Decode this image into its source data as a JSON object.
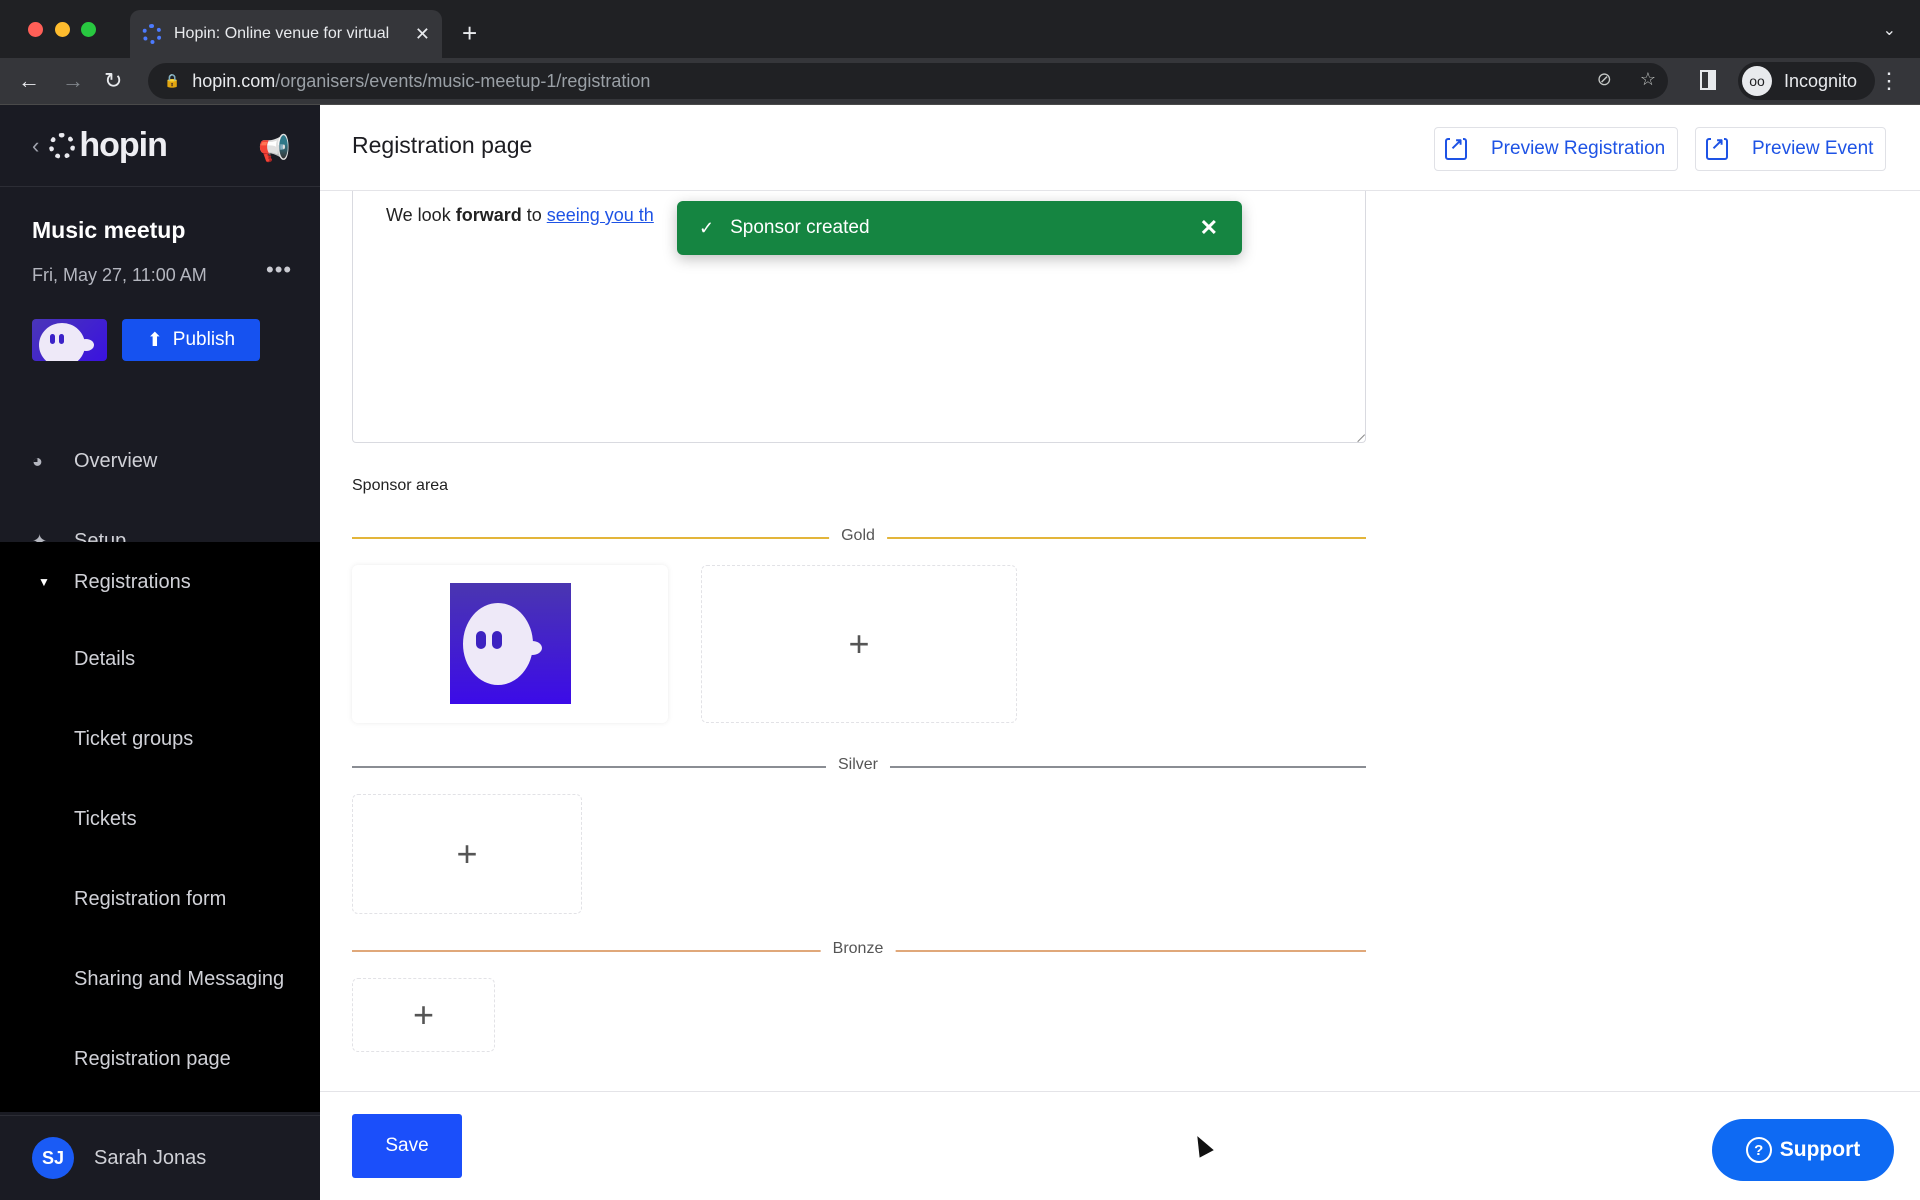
{
  "browser": {
    "tab_title": "Hopin: Online venue for virtual",
    "url_host": "hopin.com",
    "url_path": "/organisers/events/music-meetup-1/registration",
    "profile_label": "Incognito",
    "traffic_colors": [
      "#ff5f57",
      "#febc2e",
      "#28c840"
    ]
  },
  "sidebar": {
    "brand": "hopin",
    "event_name": "Music meetup",
    "event_date": "Fri, May 27, 11:00 AM",
    "publish_label": "Publish",
    "nav": [
      {
        "label": "Overview",
        "icon": "pie-chart-icon"
      },
      {
        "label": "Setup",
        "icon": "magic-wand-icon"
      },
      {
        "label": "Registrations",
        "icon": "caret-down-icon"
      }
    ],
    "sub_items": [
      "Details",
      "Ticket groups",
      "Tickets",
      "Registration form",
      "Sharing and Messaging",
      "Registration page"
    ],
    "user": {
      "initials": "SJ",
      "name": "Sarah Jonas"
    }
  },
  "header": {
    "title": "Registration page",
    "preview_registration": "Preview Registration",
    "preview_event": "Preview Event"
  },
  "editor": {
    "text_pre": "We look ",
    "text_bold": "forward",
    "text_mid": " to ",
    "text_link": "seeing you th"
  },
  "toast": {
    "message": "Sponsor created",
    "color": "#158541"
  },
  "sponsors": {
    "label": "Sponsor area",
    "tiers": [
      {
        "name": "Gold",
        "color": "#e3b53a",
        "sponsor_count": 1
      },
      {
        "name": "Silver",
        "color": "#8a8d93",
        "sponsor_count": 0
      },
      {
        "name": "Bronze",
        "color": "#e0a87a",
        "sponsor_count": 0
      }
    ]
  },
  "footer": {
    "save_label": "Save",
    "support_label": "Support"
  }
}
